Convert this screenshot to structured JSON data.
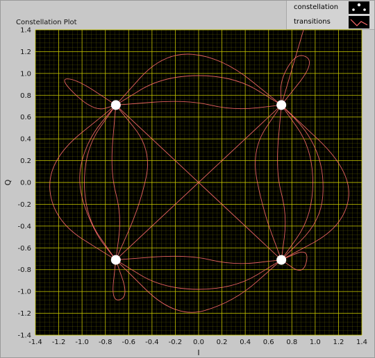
{
  "window": {
    "title": "Constellation Plot"
  },
  "legend": {
    "items": [
      {
        "label": "constellation",
        "icon": "dots-icon"
      },
      {
        "label": "transitions",
        "icon": "line-icon"
      }
    ]
  },
  "colors": {
    "plot_background": "#000000",
    "grid": "#c8c800",
    "transitions": "#ff6b6b",
    "constellation": "#ffffff",
    "panel": "#c8c8c8"
  },
  "chart_data": {
    "type": "scatter",
    "title": "Constellation Plot",
    "xlabel": "I",
    "ylabel": "Q",
    "xlim": [
      -1.4,
      1.4
    ],
    "ylim": [
      -1.4,
      1.4
    ],
    "xticks": [
      "-1.4",
      "-1.2",
      "-1.0",
      "-0.8",
      "-0.6",
      "-0.4",
      "-0.2",
      "0.0",
      "0.2",
      "0.4",
      "0.6",
      "0.8",
      "1.0",
      "1.2",
      "1.4"
    ],
    "yticks": [
      "1.4",
      "1.2",
      "1.0",
      "0.8",
      "0.6",
      "0.4",
      "0.2",
      "0.0",
      "-0.2",
      "-0.4",
      "-0.6",
      "-0.8",
      "-1.0",
      "-1.2",
      "-1.4"
    ],
    "grid": true,
    "legend_position": "top-right",
    "series": [
      {
        "name": "constellation",
        "points": [
          [
            -0.71,
            0.71
          ],
          [
            0.71,
            0.71
          ],
          [
            -0.71,
            -0.71
          ],
          [
            0.71,
            -0.71
          ]
        ]
      },
      {
        "name": "transitions",
        "paths": [
          [
            [
              -0.71,
              0.71
            ],
            [
              -0.3,
              0.98
            ],
            [
              0.3,
              0.98
            ],
            [
              0.71,
              0.71
            ]
          ],
          [
            [
              0.71,
              0.71
            ],
            [
              0.98,
              0.3
            ],
            [
              0.98,
              -0.3
            ],
            [
              0.71,
              -0.71
            ]
          ],
          [
            [
              0.71,
              -0.71
            ],
            [
              0.3,
              -0.98
            ],
            [
              -0.3,
              -0.98
            ],
            [
              -0.71,
              -0.71
            ]
          ],
          [
            [
              -0.71,
              -0.71
            ],
            [
              -0.98,
              -0.3
            ],
            [
              -0.98,
              0.3
            ],
            [
              -0.71,
              0.71
            ]
          ],
          [
            [
              -0.71,
              0.71
            ],
            [
              -0.2,
              0.2
            ],
            [
              0.2,
              -0.2
            ],
            [
              0.71,
              -0.71
            ]
          ],
          [
            [
              0.71,
              0.71
            ],
            [
              0.2,
              0.2
            ],
            [
              -0.2,
              -0.2
            ],
            [
              -0.71,
              -0.71
            ]
          ],
          [
            [
              -0.71,
              0.71
            ],
            [
              -0.1,
              0.76
            ],
            [
              0.3,
              0.66
            ],
            [
              0.71,
              0.71
            ]
          ],
          [
            [
              -0.71,
              -0.71
            ],
            [
              -0.1,
              -0.66
            ],
            [
              0.3,
              -0.76
            ],
            [
              0.71,
              -0.71
            ]
          ],
          [
            [
              -0.71,
              0.71
            ],
            [
              -0.76,
              0.1
            ],
            [
              -0.66,
              -0.3
            ],
            [
              -0.71,
              -0.71
            ]
          ],
          [
            [
              0.71,
              0.71
            ],
            [
              0.66,
              0.1
            ],
            [
              0.76,
              -0.3
            ],
            [
              0.71,
              -0.71
            ]
          ],
          [
            [
              -0.71,
              0.71
            ],
            [
              -1.05,
              0.95
            ],
            [
              -1.2,
              0.95
            ],
            [
              -0.9,
              0.65
            ],
            [
              -0.71,
              0.71
            ]
          ],
          [
            [
              0.71,
              0.71
            ],
            [
              1.0,
              1.1
            ],
            [
              0.85,
              1.2
            ],
            [
              0.7,
              0.95
            ],
            [
              0.71,
              0.71
            ]
          ],
          [
            [
              -0.71,
              -0.71
            ],
            [
              -0.75,
              -1.1
            ],
            [
              -0.6,
              -1.05
            ],
            [
              -0.71,
              -0.71
            ]
          ],
          [
            [
              0.71,
              -0.71
            ],
            [
              0.95,
              -0.6
            ],
            [
              0.9,
              -0.85
            ],
            [
              0.71,
              -0.71
            ]
          ],
          [
            [
              0.71,
              0.71
            ],
            [
              0.9,
              1.4
            ]
          ],
          [
            [
              -0.71,
              0.71
            ],
            [
              -0.95,
              0.4
            ],
            [
              -1.05,
              0.0
            ],
            [
              -0.9,
              -0.45
            ],
            [
              -0.71,
              -0.71
            ]
          ],
          [
            [
              0.71,
              -0.71
            ],
            [
              1.05,
              -0.35
            ],
            [
              1.08,
              0.1
            ],
            [
              0.95,
              0.45
            ],
            [
              0.71,
              0.71
            ]
          ],
          [
            [
              -0.71,
              0.71
            ],
            [
              -0.3,
              1.2
            ],
            [
              0.2,
              1.15
            ],
            [
              0.71,
              0.71
            ]
          ],
          [
            [
              -0.71,
              -0.71
            ],
            [
              -0.2,
              -1.25
            ],
            [
              0.3,
              -1.1
            ],
            [
              0.71,
              -0.71
            ]
          ],
          [
            [
              -0.71,
              0.71
            ],
            [
              -0.4,
              0.3
            ],
            [
              -0.5,
              -0.2
            ],
            [
              -0.71,
              -0.71
            ]
          ],
          [
            [
              0.71,
              0.71
            ],
            [
              0.45,
              0.3
            ],
            [
              0.55,
              -0.25
            ],
            [
              0.71,
              -0.71
            ]
          ],
          [
            [
              -0.71,
              0.71
            ],
            [
              -1.3,
              0.2
            ],
            [
              -1.25,
              -0.35
            ],
            [
              -0.71,
              -0.71
            ]
          ],
          [
            [
              0.71,
              0.71
            ],
            [
              1.32,
              0.1
            ],
            [
              1.25,
              -0.4
            ],
            [
              0.71,
              -0.71
            ]
          ]
        ]
      }
    ]
  }
}
